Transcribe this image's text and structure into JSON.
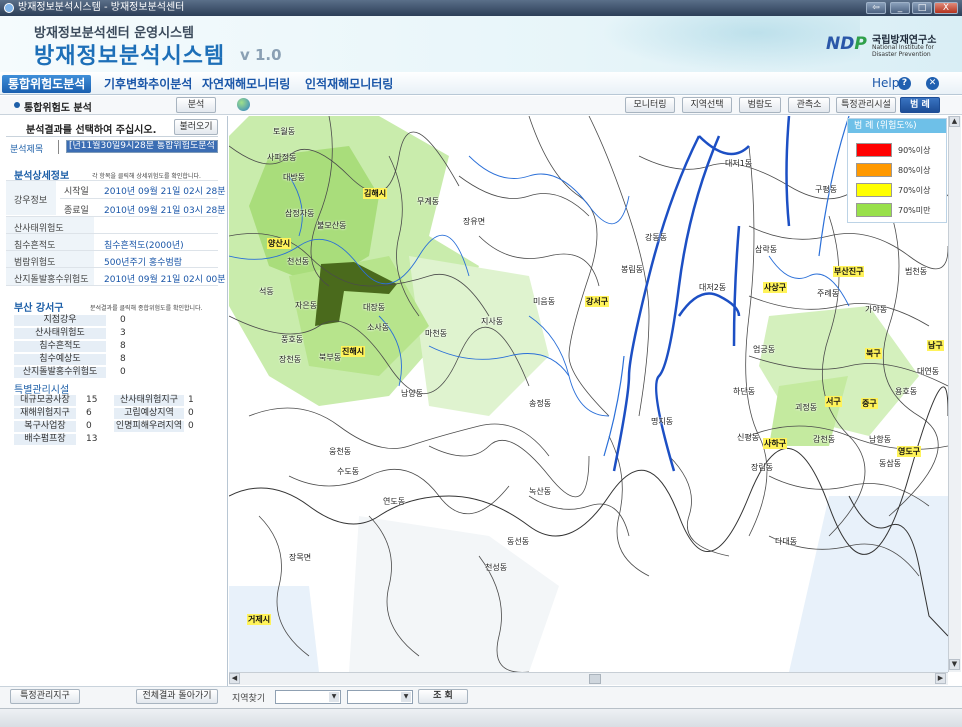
{
  "window": {
    "title": "방재정보분석시스템 - 방재정보분석센터",
    "min_label": "_",
    "max_label": "□",
    "close_label": "X"
  },
  "header": {
    "subtitle": "방재정보분석센터 운영시스템",
    "title": "방재정보분석시스템",
    "version": "v 1.0",
    "logo_mark": "NDP",
    "org_name": "국립방재연구소",
    "org_eng": "National Institute for Disaster Prevention"
  },
  "nav": {
    "tabs": [
      "통합위험도분석",
      "기후변화추이분석",
      "자연재해모니터링",
      "인적재해모니터링"
    ],
    "help_label": "Help",
    "help_icon": "?",
    "close_icon": "✕"
  },
  "subbar": {
    "title": "통합위험도 분석",
    "analyze_label": "분석",
    "tools": [
      "모니터링",
      "지역선택",
      "범람도",
      "관측소",
      "특정관리시설",
      "범 례"
    ]
  },
  "panel": {
    "select_prompt": "분석결과를 선택하여 주십시오.",
    "load_label": "불러오기",
    "analysis_title_label": "분석제목",
    "analysis_title_value": "[년11월30일9시28분 통합위험도분석",
    "detail": {
      "title": "분석상세정보",
      "hint": "각 항목을 클릭해 상세위험도를 확인합니다.",
      "rain_label": "강우정보",
      "start_label": "시작일",
      "start_value": "2010년 09월 21일 02시 28분",
      "end_label": "종료일",
      "end_value": "2010년 09월 21일 03시 28분",
      "landslide_label": "산사태위험도",
      "inund_label": "침수흔적도",
      "inund_value": "침수흔적도(2000년)",
      "flood_label": "범람위험도",
      "flood_value": "500년주기 홍수범람",
      "debris_label": "산지돌발홍수위험도",
      "debris_value": "2010년 09월 21일 02시 00분"
    },
    "district": {
      "title": "부산 강서구",
      "hint": "분석결과를 클릭해 종합위험도를 확인합니다.",
      "rows": [
        {
          "label": "지점강우",
          "value": "0"
        },
        {
          "label": "산사태위험도",
          "value": "3"
        },
        {
          "label": "침수흔적도",
          "value": "8"
        },
        {
          "label": "침수예상도",
          "value": "8"
        },
        {
          "label": "산지돌발홍수위험도",
          "value": "0"
        }
      ]
    },
    "facilities": {
      "title": "특별관리시설",
      "rows": [
        {
          "l1": "대규모공사장",
          "v1": "15",
          "l2": "산사태위험지구",
          "v2": "1"
        },
        {
          "l1": "재해위험지구",
          "v1": "6",
          "l2": "고립예상지역",
          "v2": "0"
        },
        {
          "l1": "복구사업장",
          "v1": "0",
          "l2": "인명피해우려지역",
          "v2": "0"
        },
        {
          "l1": "배수펌프장",
          "v1": "13",
          "l2": "",
          "v2": ""
        }
      ]
    }
  },
  "legend": {
    "title": "범 례 (위험도%)",
    "items": [
      {
        "color": "#ff0000",
        "label": "90%이상"
      },
      {
        "color": "#ff9900",
        "label": "80%이상"
      },
      {
        "color": "#ffff00",
        "label": "70%이상"
      },
      {
        "color": "#99e04a",
        "label": "70%미만"
      }
    ]
  },
  "map": {
    "districts": [
      "강서구",
      "사상구",
      "부산진구",
      "서구",
      "중구",
      "사하구",
      "영도구",
      "남구",
      "북구"
    ],
    "towns": [
      "김해시",
      "양산시",
      "진해시",
      "거제시"
    ],
    "places": [
      "토월동",
      "사파정동",
      "대방동",
      "삼정자동",
      "불모산동",
      "천선동",
      "석동",
      "자은동",
      "풍호동",
      "장천동",
      "북부동",
      "대장동",
      "소사동",
      "마천동",
      "지사동",
      "남양동",
      "웅천동",
      "수도동",
      "연도동",
      "장목면",
      "동선동",
      "천성동",
      "대저1동",
      "대저2동",
      "강동동",
      "명지동",
      "하단동",
      "괴정동",
      "감천동",
      "다대동",
      "신평동",
      "장림동",
      "구평동",
      "송정동",
      "무계동",
      "장유면",
      "미음동",
      "녹산동",
      "봉림동",
      "삼락동",
      "엄궁동",
      "주례동",
      "가야동",
      "범천동",
      "대연동",
      "용호동",
      "동삼동",
      "남항동"
    ]
  },
  "bottom": {
    "special_label": "특정관리지구",
    "return_label": "전체결과 돌아가기",
    "region_label": "지역찾기",
    "search_label": "조 회"
  }
}
